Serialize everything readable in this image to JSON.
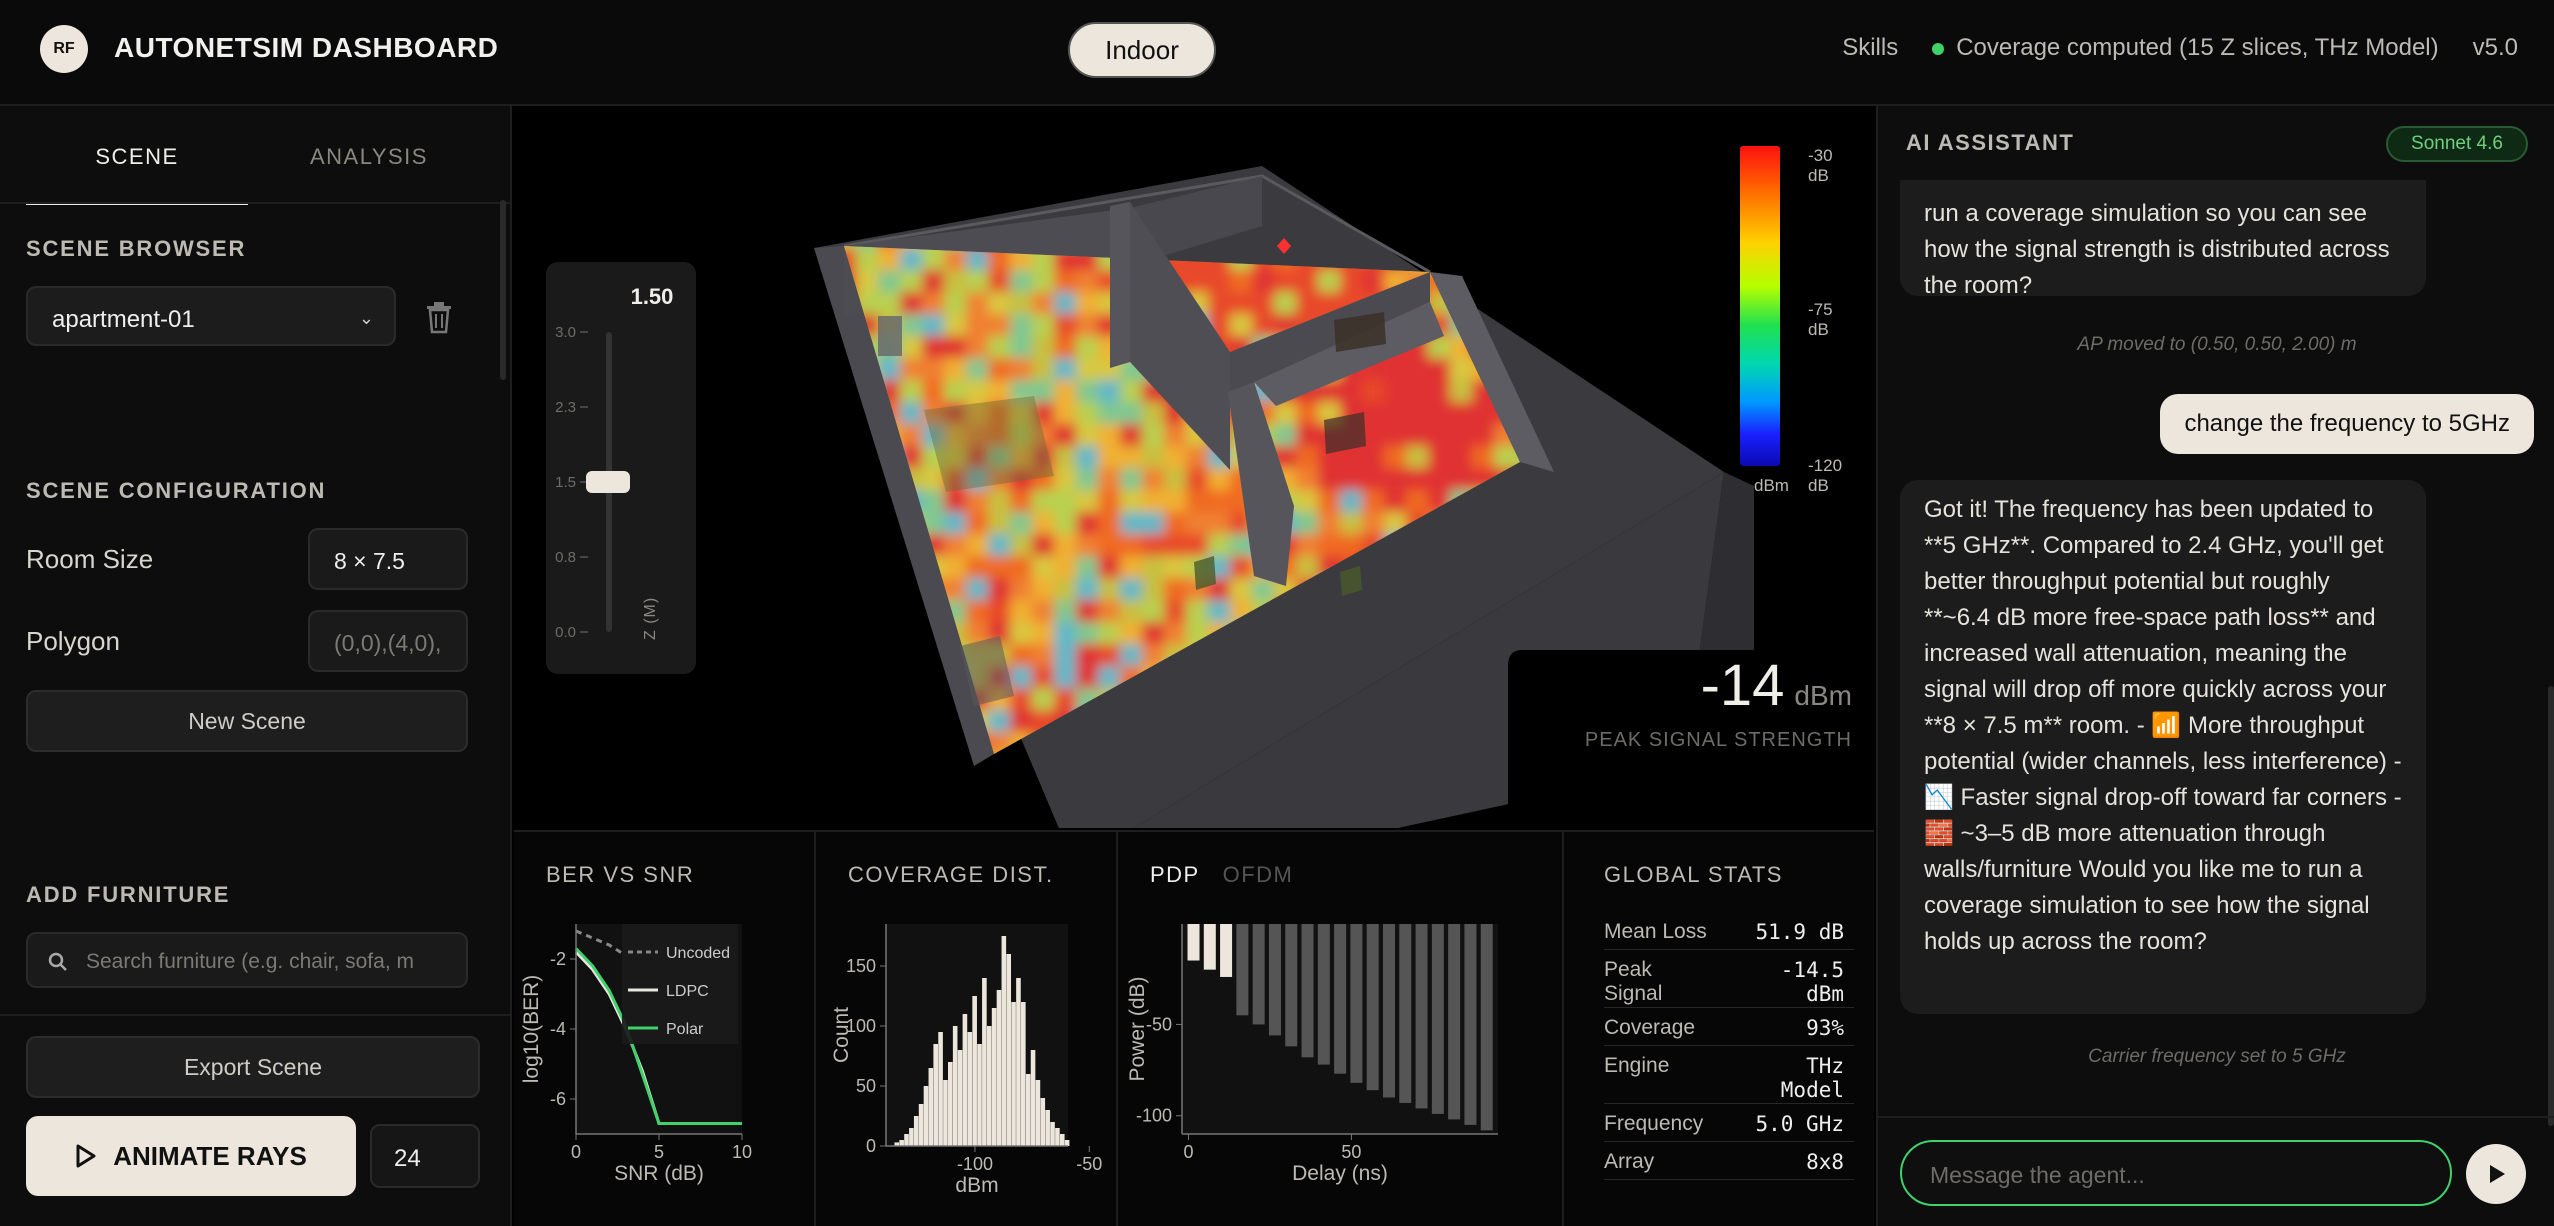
{
  "header": {
    "logo_text": "RF",
    "title": "AUTONETSIM DASHBOARD",
    "mode": "Indoor",
    "skills": "Skills",
    "status": "Coverage computed (15 Z slices, THz Model)",
    "version": "v5.0",
    "status_color": "#3fd16a"
  },
  "left": {
    "tabs": {
      "scene": "SCENE",
      "analysis": "ANALYSIS"
    },
    "scene_browser": {
      "title": "SCENE BROWSER",
      "selected": "apartment-01"
    },
    "scene_config": {
      "title": "SCENE CONFIGURATION",
      "room_size_label": "Room Size",
      "room_size_value": "8 × 7.5",
      "polygon_label": "Polygon",
      "polygon_placeholder": "(0,0),(4,0),",
      "new_scene": "New Scene"
    },
    "furniture": {
      "title": "ADD FURNITURE",
      "search_placeholder": "Search furniture (e.g. chair, sofa, m"
    },
    "export": "Export Scene",
    "animate": "ANIMATE RAYS",
    "ray_count": "24"
  },
  "viewport": {
    "z_slider": {
      "value": "1.50",
      "ticks": [
        "3.0",
        "2.3",
        "1.5",
        "0.8",
        "0.0"
      ],
      "axis_label": "Z (M)",
      "level": 0.5
    },
    "colorbar": {
      "top": "-30",
      "mid": "-75",
      "bottom": "-120",
      "unit": "dB",
      "bottom_unit": "dBm"
    },
    "peak": {
      "value": "-14",
      "unit": "dBm",
      "label": "PEAK SIGNAL STRENGTH"
    }
  },
  "panels": {
    "ber": {
      "title": "BER VS SNR"
    },
    "coverage": {
      "title": "COVERAGE DIST."
    },
    "pdp": {
      "tab_active": "PDP",
      "tab_inactive": "OFDM"
    },
    "stats": {
      "title": "GLOBAL STATS",
      "rows": [
        {
          "k": "Mean Loss",
          "v": "51.9 dB"
        },
        {
          "k": "Peak\nSignal",
          "v": "-14.5\ndBm"
        },
        {
          "k": "Coverage",
          "v": "93%"
        },
        {
          "k": "Engine",
          "v": "THz\nModel"
        },
        {
          "k": "Frequency",
          "v": "5.0 GHz"
        },
        {
          "k": "Array",
          "v": "8x8"
        }
      ]
    }
  },
  "chart_data": [
    {
      "type": "line",
      "title": "",
      "xlabel": "SNR (dB)",
      "ylabel": "log10(BER)",
      "xlim": [
        0,
        10
      ],
      "ylim": [
        -7,
        -1
      ],
      "x_ticks": [
        "0",
        "5",
        "10"
      ],
      "y_ticks": [
        "-2",
        "-4",
        "-6"
      ],
      "legend_position": "top-right",
      "series": [
        {
          "name": "Uncoded",
          "color": "#888888",
          "dashed": true,
          "x": [
            0,
            1,
            2,
            3
          ],
          "y": [
            -1.2,
            -1.4,
            -1.6,
            -1.9
          ]
        },
        {
          "name": "LDPC",
          "color": "#e8e6e0",
          "x": [
            0,
            1,
            2,
            3,
            4,
            5,
            6,
            7,
            8,
            9,
            10
          ],
          "y": [
            -1.8,
            -2.3,
            -3.0,
            -4.0,
            -5.2,
            -6.7,
            -6.7,
            -6.7,
            -6.7,
            -6.7,
            -6.7
          ]
        },
        {
          "name": "Polar",
          "color": "#3fd16a",
          "x": [
            0,
            1,
            2,
            3,
            4,
            5,
            6,
            7,
            8,
            9,
            10
          ],
          "y": [
            -1.7,
            -2.2,
            -2.9,
            -3.9,
            -5.3,
            -6.7,
            -6.7,
            -6.7,
            -6.7,
            -6.7,
            -6.7
          ]
        }
      ]
    },
    {
      "type": "bar",
      "title": "",
      "xlabel": "dBm",
      "ylabel": "Count",
      "xlim": [
        -115,
        -72
      ],
      "ylim": [
        0,
        185
      ],
      "x_ticks": [
        "-100",
        "-50"
      ],
      "y_ticks": [
        "0",
        "50",
        "100",
        "150"
      ],
      "bin_centers": [
        -96,
        -94,
        -92,
        -90,
        -88,
        -86,
        -84,
        -82,
        -80,
        -78,
        -76,
        -74,
        -72,
        -70,
        -68,
        -66,
        -64,
        -62,
        -60,
        -58,
        -56,
        -54,
        -52,
        -50,
        -48,
        -46,
        -44,
        -42,
        -40,
        -38,
        -36,
        -34,
        -32,
        -30,
        -28,
        -26
      ],
      "values": [
        3,
        5,
        10,
        15,
        25,
        35,
        50,
        65,
        85,
        95,
        55,
        70,
        100,
        80,
        110,
        95,
        125,
        85,
        140,
        100,
        115,
        130,
        175,
        160,
        120,
        140,
        120,
        60,
        80,
        55,
        40,
        30,
        20,
        15,
        10,
        5
      ]
    },
    {
      "type": "bar",
      "title": "",
      "xlabel": "Delay (ns)",
      "ylabel": "Power (dB)",
      "xlim": [
        -2,
        95
      ],
      "ylim": [
        -110,
        5
      ],
      "x_ticks": [
        "0",
        "50"
      ],
      "y_ticks": [
        "-50",
        "-100"
      ],
      "delays": [
        0,
        5,
        10,
        15,
        20,
        25,
        30,
        35,
        40,
        45,
        50,
        55,
        60,
        65,
        70,
        75,
        80,
        85,
        90
      ],
      "values": [
        -15,
        -20,
        -24,
        -45,
        -50,
        -56,
        -62,
        -68,
        -72,
        -77,
        -82,
        -86,
        -90,
        -93,
        -96,
        -99,
        -102,
        -105,
        -108
      ],
      "highlight_first": 3,
      "highlight_color": "#ece6dc",
      "bar_color": "#555555"
    }
  ],
  "chat": {
    "title": "AI ASSISTANT",
    "model": "Sonnet 4.6",
    "msg1": "run a coverage simulation so you can see how the signal strength is distributed across the room?",
    "sys1": "AP moved to (0.50, 0.50, 2.00) m",
    "user1": "change the frequency to 5GHz",
    "msg2": "Got it! The frequency has been updated to **5 GHz**. Compared to 2.4 GHz, you'll get better throughput potential but roughly **~6.4 dB more free-space path loss** and increased wall attenuation, meaning the signal will drop off more quickly across your **8 × 7.5 m** room. - 📶 More throughput potential (wider channels, less interference) - 📉 Faster signal drop-off toward far corners - 🧱 ~3–5 dB more attenuation through walls/furniture Would you like me to run a coverage simulation to see how the signal holds up across the room?",
    "sys2": "Carrier frequency set to 5 GHz",
    "input_placeholder": "Message the agent..."
  }
}
